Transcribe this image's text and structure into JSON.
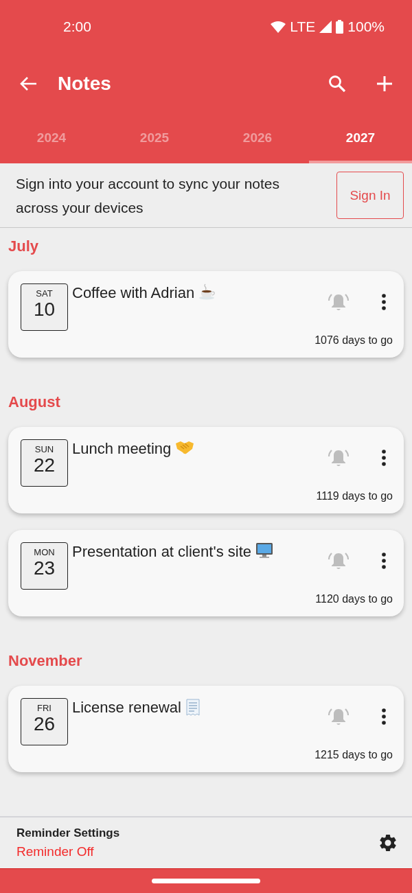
{
  "status_bar": {
    "time": "2:00",
    "network": "LTE",
    "battery": "100%"
  },
  "toolbar": {
    "title": "Notes"
  },
  "tabs": [
    {
      "label": "2024",
      "selected": false
    },
    {
      "label": "2025",
      "selected": false
    },
    {
      "label": "2026",
      "selected": false
    },
    {
      "label": "2027",
      "selected": true
    }
  ],
  "sign_in_banner": {
    "message": "Sign into your account to sync your notes across your devices",
    "button": "Sign In"
  },
  "months": [
    {
      "name": "July",
      "notes": [
        {
          "weekday": "SAT",
          "day": "10",
          "title": "Coffee with Adrian",
          "kind": "coffee",
          "reminder_on": false,
          "countdown": "1076 days to go"
        }
      ]
    },
    {
      "name": "August",
      "notes": [
        {
          "weekday": "SUN",
          "day": "22",
          "title": "Lunch meeting",
          "kind": "handshake",
          "reminder_on": false,
          "countdown": "1119 days to go"
        },
        {
          "weekday": "MON",
          "day": "23",
          "title": "Presentation at client's site",
          "kind": "monitor",
          "reminder_on": false,
          "countdown": "1120 days to go"
        }
      ]
    },
    {
      "name": "November",
      "notes": [
        {
          "weekday": "FRI",
          "day": "26",
          "title": "License renewal",
          "kind": "document",
          "reminder_on": false,
          "countdown": "1215 days to go"
        }
      ]
    }
  ],
  "footer": {
    "title": "Reminder Settings",
    "status": "Reminder Off"
  }
}
